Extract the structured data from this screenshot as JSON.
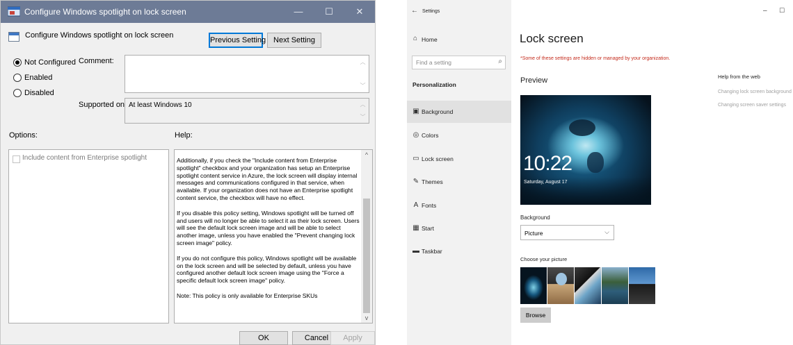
{
  "gp_dialog": {
    "window_title": "Configure Windows spotlight on lock screen",
    "window_controls": {
      "minimize": "—",
      "maximize": "☐",
      "close": "✕"
    },
    "policy_title": "Configure Windows spotlight on lock screen",
    "prev_button": "Previous Setting",
    "next_button": "Next Setting",
    "radios": [
      {
        "label": "Not Configured",
        "selected": true
      },
      {
        "label": "Enabled",
        "selected": false
      },
      {
        "label": "Disabled",
        "selected": false
      }
    ],
    "comment_label": "Comment:",
    "comment_value": "",
    "supported_label": "Supported on:",
    "supported_value": "At least Windows 10",
    "options_label": "Options:",
    "help_label": "Help:",
    "option_checkbox": {
      "label": "Include content from Enterprise spotlight",
      "checked": false,
      "enabled": false
    },
    "help_paragraphs": [
      "Additionally, if you check the \"Include content from Enterprise spotlight\" checkbox and your organization has setup an Enterprise spotlight content service in Azure, the lock screen will display internal messages and communications configured in that service, when available. If your organization does not have an Enterprise spotlight content service, the checkbox will have no effect.",
      "If you disable this policy setting, Windows spotlight will be turned off and users will no longer be able to select it as their lock screen. Users will see the default lock screen image and will be able to select another image, unless you have enabled the \"Prevent changing lock screen image\" policy.",
      "If you do not configure this policy, Windows spotlight will be available on the lock screen and will be selected by default, unless you have configured another default lock screen image using the \"Force a specific default lock screen image\" policy.",
      "Note: This policy is only available for Enterprise SKUs"
    ],
    "ok_button": "OK",
    "cancel_button": "Cancel",
    "apply_button": "Apply"
  },
  "settings": {
    "back_arrow": "←",
    "window_title": "Settings",
    "window_controls": {
      "minimize": "–",
      "maximize": "☐"
    },
    "home_label": "Home",
    "search_placeholder": "Find a setting",
    "section_label": "Personalization",
    "nav_items": [
      {
        "label": "Background",
        "icon": "picture-icon",
        "glyph": "▣",
        "active": true
      },
      {
        "label": "Colors",
        "icon": "palette-icon",
        "glyph": "◎",
        "active": false
      },
      {
        "label": "Lock screen",
        "icon": "lock-screen-icon",
        "glyph": "▭",
        "active": false
      },
      {
        "label": "Themes",
        "icon": "themes-icon",
        "glyph": "✎",
        "active": false
      },
      {
        "label": "Fonts",
        "icon": "fonts-icon",
        "glyph": "A",
        "active": false
      },
      {
        "label": "Start",
        "icon": "start-icon",
        "glyph": "▦",
        "active": false
      },
      {
        "label": "Taskbar",
        "icon": "taskbar-icon",
        "glyph": "▬",
        "active": false
      }
    ],
    "page_title": "Lock screen",
    "managed_notice": "*Some of these settings are hidden or managed by your organization.",
    "preview_label": "Preview",
    "lock_time": "10:22",
    "lock_date": "Saturday, August 17",
    "background_label": "Background",
    "background_value": "Picture",
    "choose_picture_label": "Choose your picture",
    "browse_button": "Browse",
    "help_heading": "Help from the web",
    "help_links": [
      "Changing lock screen background",
      "Changing screen saver settings"
    ],
    "colors": {
      "accent_link": "#a0a0a0",
      "warning": "#c42b1c",
      "titlebar": "#6d7b96",
      "focus": "#0078d7"
    }
  }
}
